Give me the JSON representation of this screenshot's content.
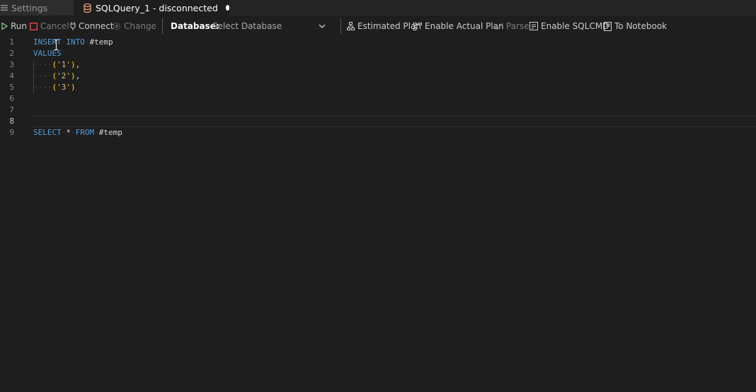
{
  "tabs": [
    {
      "label": "Settings",
      "icon": "settings-icon",
      "active": false
    },
    {
      "label": "SQLQuery_1 - disconnected",
      "icon": "database-icon",
      "active": true,
      "modified": true
    }
  ],
  "toolbar": {
    "run": "Run",
    "cancel": "Cancel",
    "connect": "Connect",
    "change": "Change",
    "database_label": "Database:",
    "database_value": "Select Database",
    "estimated_plan": "Estimated Plan",
    "actual_plan": "Enable Actual Plan",
    "parse": "Parse",
    "sqlcmd": "Enable SQLCMD",
    "notebook": "To Notebook"
  },
  "editor": {
    "line_numbers": [
      "1",
      "2",
      "3",
      "4",
      "5",
      "6",
      "7",
      "8",
      "9"
    ],
    "active_line": 8,
    "lines": [
      [
        {
          "t": "INSERT",
          "c": "kw"
        },
        {
          "t": "·",
          "c": "ws"
        },
        {
          "t": "INTO",
          "c": "kw"
        },
        {
          "t": "·",
          "c": "ws"
        },
        {
          "t": "#temp",
          "c": "ident"
        }
      ],
      [
        {
          "t": "VALUES",
          "c": "kw"
        }
      ],
      [
        {
          "t": "····",
          "c": "ws"
        },
        {
          "t": "(",
          "c": "punct"
        },
        {
          "t": "'1'",
          "c": "str"
        },
        {
          "t": ")",
          "c": "punct"
        },
        {
          "t": ",",
          "c": "ident"
        }
      ],
      [
        {
          "t": "····",
          "c": "ws"
        },
        {
          "t": "(",
          "c": "punct"
        },
        {
          "t": "'2'",
          "c": "str"
        },
        {
          "t": ")",
          "c": "punct"
        },
        {
          "t": ",",
          "c": "ident"
        }
      ],
      [
        {
          "t": "····",
          "c": "ws"
        },
        {
          "t": "(",
          "c": "punct"
        },
        {
          "t": "'3'",
          "c": "str"
        },
        {
          "t": ")",
          "c": "punct"
        }
      ],
      [],
      [],
      [],
      [
        {
          "t": "SELECT",
          "c": "kw"
        },
        {
          "t": "·",
          "c": "ws"
        },
        {
          "t": "*",
          "c": "ident"
        },
        {
          "t": "·",
          "c": "ws"
        },
        {
          "t": "FROM",
          "c": "kw"
        },
        {
          "t": "·",
          "c": "ws"
        },
        {
          "t": "#temp",
          "c": "ident"
        }
      ]
    ]
  },
  "colors": {
    "background": "#1e1e1e",
    "tabbar": "#252526",
    "keyword": "#569cd6",
    "string": "#d7ba7d",
    "bracket": "#ffd700",
    "run_green": "#89d185",
    "cancel_red": "#f14c4c"
  }
}
